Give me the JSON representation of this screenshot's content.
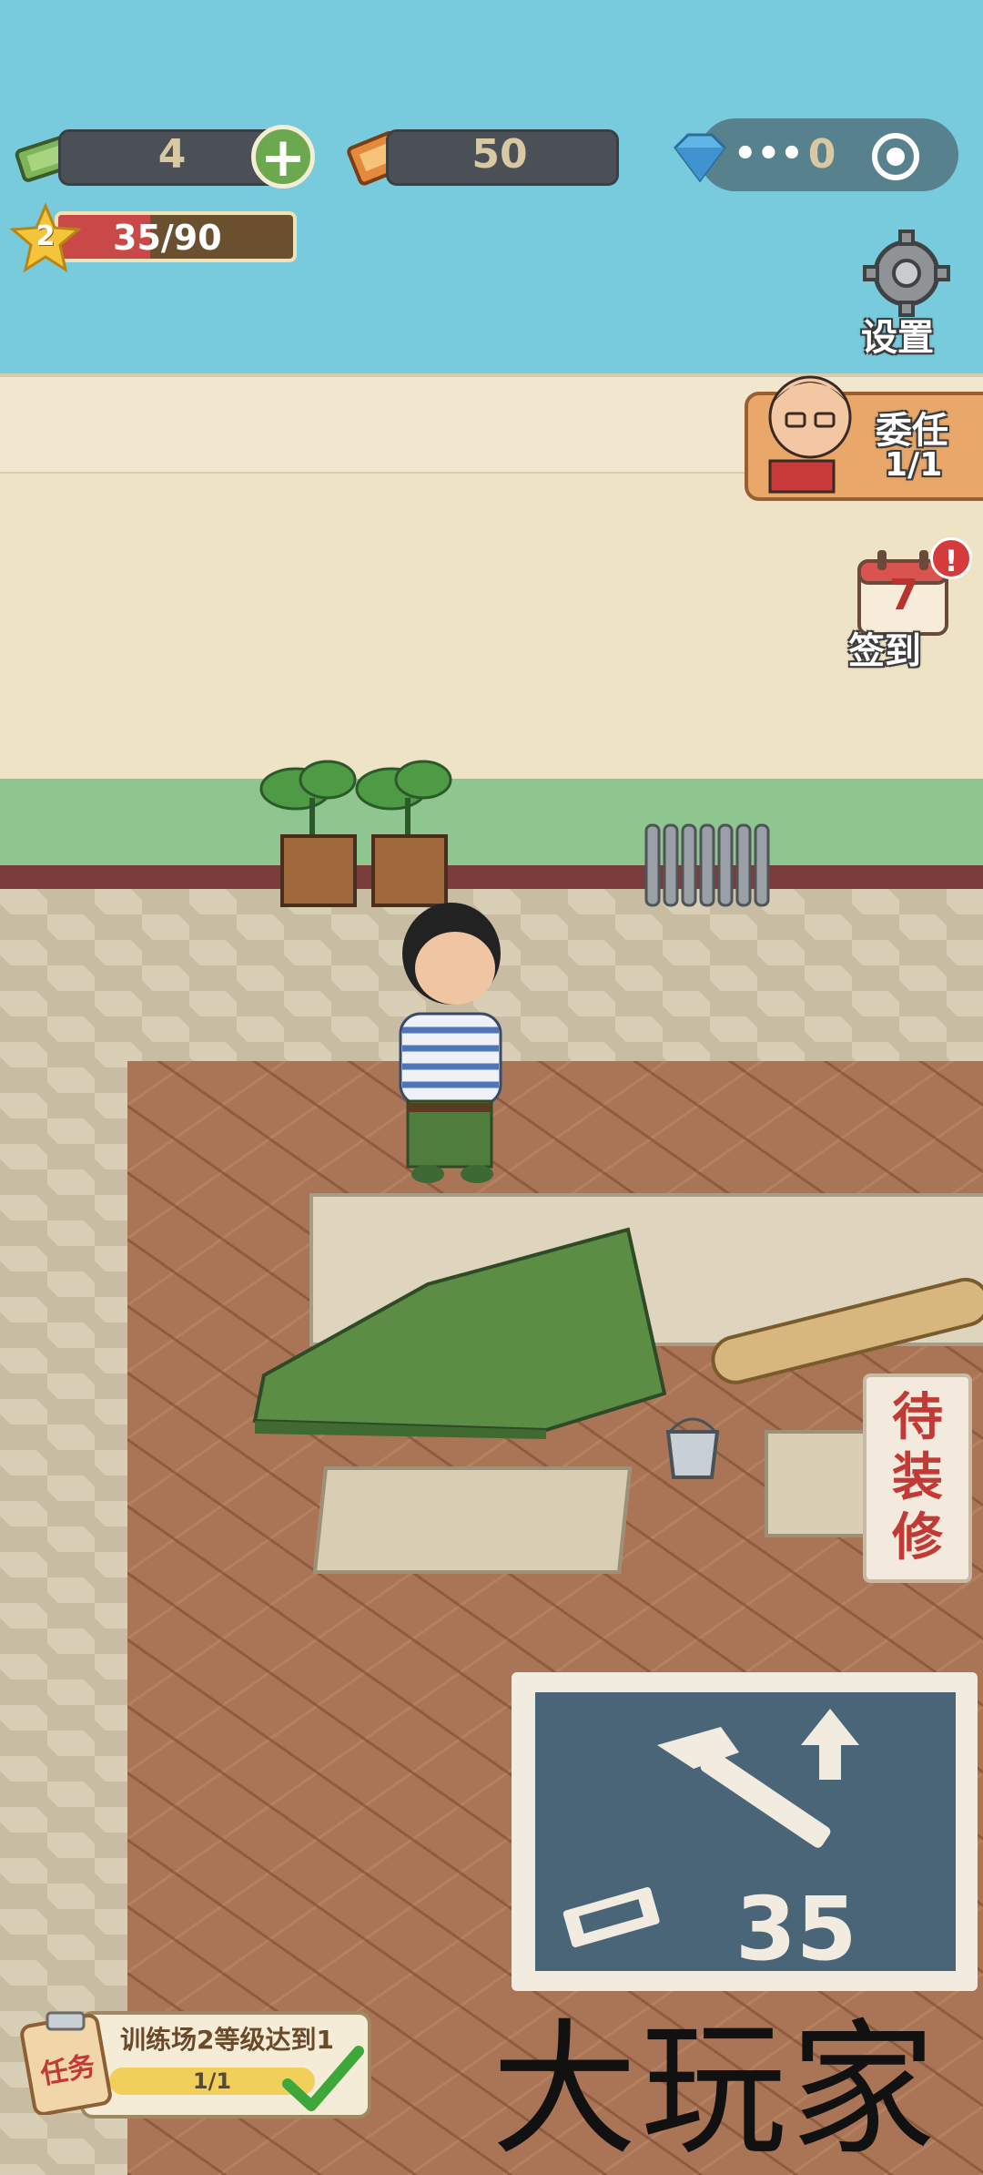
{
  "hud": {
    "cash": {
      "value": "4",
      "icon": "cash-icon"
    },
    "tickets": {
      "value": "50",
      "icon": "ticket-icon"
    },
    "gems": {
      "value": "0",
      "icon": "diamond-icon"
    },
    "level": {
      "number": "2",
      "xp_text": "35/90",
      "xp_fraction": 0.39
    }
  },
  "side_buttons": {
    "settings": {
      "label": "设置"
    },
    "delegate": {
      "label": "委任",
      "count": "1/1"
    },
    "checkin": {
      "label": "签到",
      "day": "7",
      "badge": "!"
    }
  },
  "scene": {
    "sign_text": [
      "待",
      "装",
      "修"
    ],
    "upgrade": {
      "cost": "35"
    }
  },
  "task": {
    "icon_label": "任务",
    "text": "训练场2等级达到1",
    "progress": "1/1",
    "progress_fraction": 1.0
  },
  "watermark": "大玩家",
  "colors": {
    "accent_green": "#6ca84f",
    "xp_red": "#c94848",
    "upgrade_tile": "#4a6478"
  }
}
